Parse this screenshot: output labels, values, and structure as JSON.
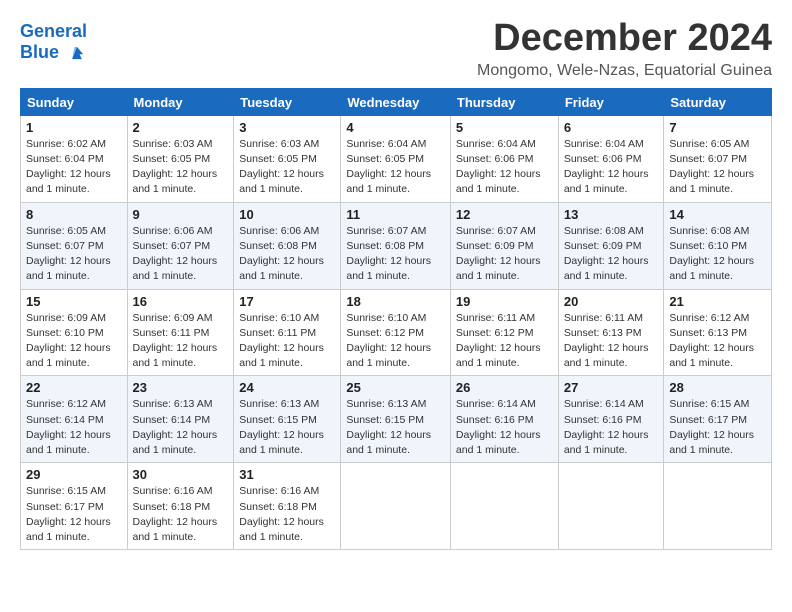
{
  "logo": {
    "line1": "General",
    "line2": "Blue"
  },
  "title": "December 2024",
  "subtitle": "Mongomo, Wele-Nzas, Equatorial Guinea",
  "days_header": [
    "Sunday",
    "Monday",
    "Tuesday",
    "Wednesday",
    "Thursday",
    "Friday",
    "Saturday"
  ],
  "weeks": [
    [
      {
        "day": "1",
        "sunrise": "6:02 AM",
        "sunset": "6:04 PM",
        "daylight": "12 hours and 1 minute."
      },
      {
        "day": "2",
        "sunrise": "6:03 AM",
        "sunset": "6:05 PM",
        "daylight": "12 hours and 1 minute."
      },
      {
        "day": "3",
        "sunrise": "6:03 AM",
        "sunset": "6:05 PM",
        "daylight": "12 hours and 1 minute."
      },
      {
        "day": "4",
        "sunrise": "6:04 AM",
        "sunset": "6:05 PM",
        "daylight": "12 hours and 1 minute."
      },
      {
        "day": "5",
        "sunrise": "6:04 AM",
        "sunset": "6:06 PM",
        "daylight": "12 hours and 1 minute."
      },
      {
        "day": "6",
        "sunrise": "6:04 AM",
        "sunset": "6:06 PM",
        "daylight": "12 hours and 1 minute."
      },
      {
        "day": "7",
        "sunrise": "6:05 AM",
        "sunset": "6:07 PM",
        "daylight": "12 hours and 1 minute."
      }
    ],
    [
      {
        "day": "8",
        "sunrise": "6:05 AM",
        "sunset": "6:07 PM",
        "daylight": "12 hours and 1 minute."
      },
      {
        "day": "9",
        "sunrise": "6:06 AM",
        "sunset": "6:07 PM",
        "daylight": "12 hours and 1 minute."
      },
      {
        "day": "10",
        "sunrise": "6:06 AM",
        "sunset": "6:08 PM",
        "daylight": "12 hours and 1 minute."
      },
      {
        "day": "11",
        "sunrise": "6:07 AM",
        "sunset": "6:08 PM",
        "daylight": "12 hours and 1 minute."
      },
      {
        "day": "12",
        "sunrise": "6:07 AM",
        "sunset": "6:09 PM",
        "daylight": "12 hours and 1 minute."
      },
      {
        "day": "13",
        "sunrise": "6:08 AM",
        "sunset": "6:09 PM",
        "daylight": "12 hours and 1 minute."
      },
      {
        "day": "14",
        "sunrise": "6:08 AM",
        "sunset": "6:10 PM",
        "daylight": "12 hours and 1 minute."
      }
    ],
    [
      {
        "day": "15",
        "sunrise": "6:09 AM",
        "sunset": "6:10 PM",
        "daylight": "12 hours and 1 minute."
      },
      {
        "day": "16",
        "sunrise": "6:09 AM",
        "sunset": "6:11 PM",
        "daylight": "12 hours and 1 minute."
      },
      {
        "day": "17",
        "sunrise": "6:10 AM",
        "sunset": "6:11 PM",
        "daylight": "12 hours and 1 minute."
      },
      {
        "day": "18",
        "sunrise": "6:10 AM",
        "sunset": "6:12 PM",
        "daylight": "12 hours and 1 minute."
      },
      {
        "day": "19",
        "sunrise": "6:11 AM",
        "sunset": "6:12 PM",
        "daylight": "12 hours and 1 minute."
      },
      {
        "day": "20",
        "sunrise": "6:11 AM",
        "sunset": "6:13 PM",
        "daylight": "12 hours and 1 minute."
      },
      {
        "day": "21",
        "sunrise": "6:12 AM",
        "sunset": "6:13 PM",
        "daylight": "12 hours and 1 minute."
      }
    ],
    [
      {
        "day": "22",
        "sunrise": "6:12 AM",
        "sunset": "6:14 PM",
        "daylight": "12 hours and 1 minute."
      },
      {
        "day": "23",
        "sunrise": "6:13 AM",
        "sunset": "6:14 PM",
        "daylight": "12 hours and 1 minute."
      },
      {
        "day": "24",
        "sunrise": "6:13 AM",
        "sunset": "6:15 PM",
        "daylight": "12 hours and 1 minute."
      },
      {
        "day": "25",
        "sunrise": "6:13 AM",
        "sunset": "6:15 PM",
        "daylight": "12 hours and 1 minute."
      },
      {
        "day": "26",
        "sunrise": "6:14 AM",
        "sunset": "6:16 PM",
        "daylight": "12 hours and 1 minute."
      },
      {
        "day": "27",
        "sunrise": "6:14 AM",
        "sunset": "6:16 PM",
        "daylight": "12 hours and 1 minute."
      },
      {
        "day": "28",
        "sunrise": "6:15 AM",
        "sunset": "6:17 PM",
        "daylight": "12 hours and 1 minute."
      }
    ],
    [
      {
        "day": "29",
        "sunrise": "6:15 AM",
        "sunset": "6:17 PM",
        "daylight": "12 hours and 1 minute."
      },
      {
        "day": "30",
        "sunrise": "6:16 AM",
        "sunset": "6:18 PM",
        "daylight": "12 hours and 1 minute."
      },
      {
        "day": "31",
        "sunrise": "6:16 AM",
        "sunset": "6:18 PM",
        "daylight": "12 hours and 1 minute."
      },
      null,
      null,
      null,
      null
    ]
  ],
  "labels": {
    "sunrise": "Sunrise: ",
    "sunset": "Sunset: ",
    "daylight": "Daylight: "
  }
}
